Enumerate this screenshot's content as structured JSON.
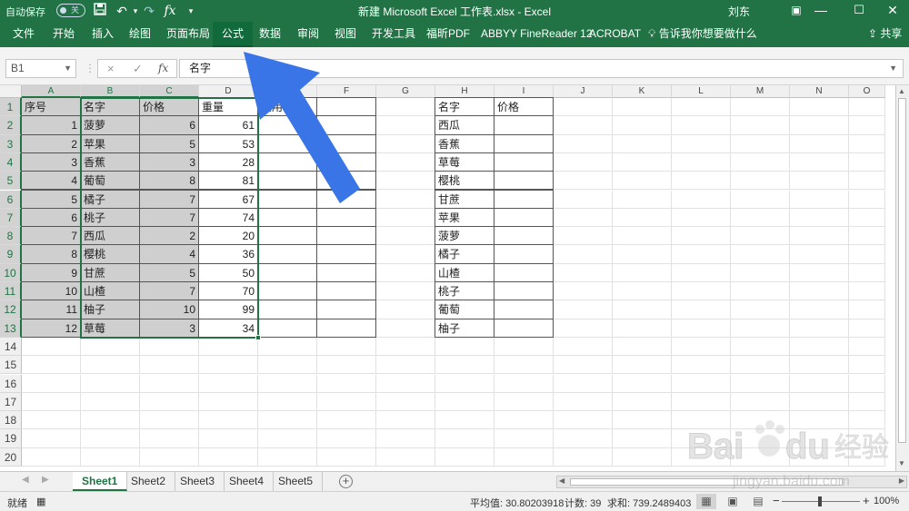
{
  "titlebar": {
    "autosave_label": "自动保存",
    "autosave_state": "关",
    "doc_title": "新建 Microsoft Excel 工作表.xlsx  -  Excel",
    "user": "刘东"
  },
  "ribbon": {
    "tabs": [
      "文件",
      "开始",
      "插入",
      "绘图",
      "页面布局",
      "公式",
      "数据",
      "审阅",
      "视图",
      "开发工具",
      "福昕PDF",
      "ABBYY FineReader 12",
      "ACROBAT"
    ],
    "active_tab": "公式",
    "tell_me": "告诉我你想要做什么",
    "share": "共享"
  },
  "formula_bar": {
    "name_box": "B1",
    "cancel": "×",
    "enter": "✓",
    "fx": "fx",
    "content": "名字"
  },
  "grid": {
    "columns": [
      "A",
      "B",
      "C",
      "D",
      "E",
      "F",
      "G",
      "H",
      "I",
      "J",
      "K",
      "L",
      "M",
      "N",
      "O"
    ],
    "rows": [
      "1",
      "2",
      "3",
      "4",
      "5",
      "6",
      "7",
      "8",
      "9",
      "10",
      "11",
      "12",
      "13",
      "14",
      "15",
      "16",
      "17",
      "18",
      "19",
      "20"
    ],
    "table1": {
      "headers": [
        "序号",
        "名字",
        "价格",
        "重量",
        "费用"
      ],
      "rows": [
        [
          "1",
          "菠萝",
          "6",
          "61"
        ],
        [
          "2",
          "苹果",
          "5",
          "53"
        ],
        [
          "3",
          "香蕉",
          "3",
          "28"
        ],
        [
          "4",
          "葡萄",
          "8",
          "81"
        ],
        [
          "5",
          "橘子",
          "7",
          "67"
        ],
        [
          "6",
          "桃子",
          "7",
          "74"
        ],
        [
          "7",
          "西瓜",
          "2",
          "20"
        ],
        [
          "8",
          "樱桃",
          "4",
          "36"
        ],
        [
          "9",
          "甘蔗",
          "5",
          "50"
        ],
        [
          "10",
          "山楂",
          "7",
          "70"
        ],
        [
          "11",
          "柚子",
          "10",
          "99"
        ],
        [
          "12",
          "草莓",
          "3",
          "34"
        ]
      ]
    },
    "table2": {
      "headers": [
        "名字",
        "价格"
      ],
      "rows": [
        "西瓜",
        "香蕉",
        "草莓",
        "樱桃",
        "甘蔗",
        "苹果",
        "菠萝",
        "橘子",
        "山楂",
        "桃子",
        "葡萄",
        "柚子"
      ]
    }
  },
  "sheets": {
    "tabs": [
      "Sheet1",
      "Sheet2",
      "Sheet3",
      "Sheet4",
      "Sheet5"
    ],
    "active": "Sheet1",
    "add": "+"
  },
  "status": {
    "mode": "就绪",
    "average": "平均值: 30.80203918",
    "count": "计数: 39",
    "sum": "求和: 739.2489403",
    "zoom": "100%",
    "zoom_out": "−",
    "zoom_in": "+"
  },
  "watermark": {
    "brand": "Bai",
    "brand2": "du",
    "brand_cn": "经验",
    "url": "jingyan.baidu.com"
  },
  "colors": {
    "excel_green": "#217346",
    "arrow_blue": "#3a75e8",
    "selection_gray": "#cfcfcf"
  },
  "icons": [
    "save-icon",
    "undo-icon",
    "fx-icon",
    "lightbulb-icon",
    "share-icon",
    "minimize-icon",
    "maximize-icon",
    "close-icon",
    "ribbon-display-icon"
  ]
}
